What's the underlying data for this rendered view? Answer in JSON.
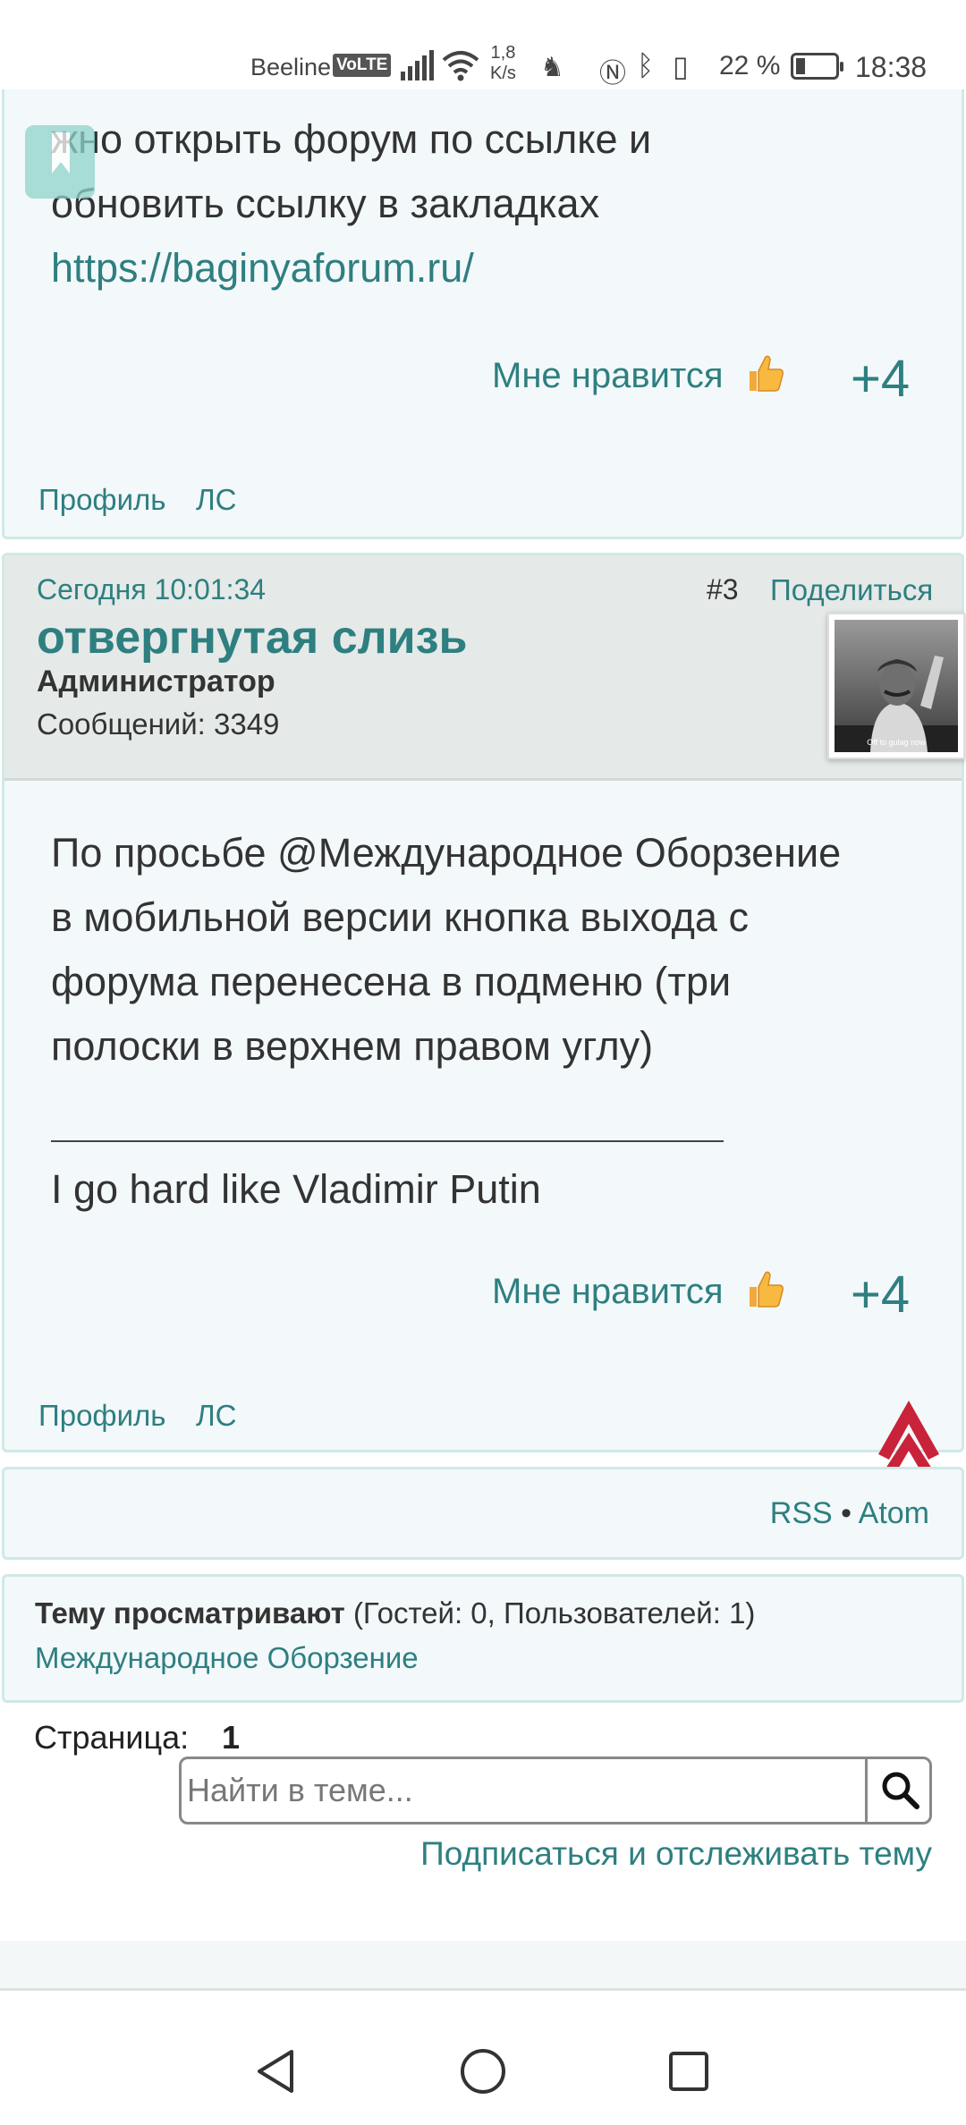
{
  "status_bar": {
    "carrier": "Beeline",
    "volte": "VoLTE",
    "speed_value": "1,8",
    "speed_unit": "K/s",
    "battery": "22 %",
    "time": "18:38",
    "icons": [
      "signal-icon",
      "wifi-icon",
      "nfc-icon",
      "bluetooth-icon",
      "vibrate-icon",
      "battery-icon"
    ]
  },
  "post1": {
    "body_lines": [
      "жно открыть форум по ссылке и",
      "обновить ссылку в закладках"
    ],
    "link": "https://baginyaforum.ru/",
    "like_label": "Мне нравится",
    "like_count": "+4",
    "profile_link": "Профиль",
    "pm_link": "ЛС"
  },
  "post2": {
    "date": "Сегодня 10:01:34",
    "number": "#3",
    "share": "Поделиться",
    "author": "отвергнутая слизь",
    "role": "Администратор",
    "messages": "Сообщений: 3349",
    "avatar_caption": "Off to gulag now",
    "body_lines": [
      "По просьбе @Международное Оборзение",
      "в мобильной версии кнопка выхода с",
      "форума перенесена в подменю (три",
      "полоски в верхнем правом углу)"
    ],
    "signature": "I go hard like Vladimir Putin",
    "like_label": "Мне нравится",
    "like_count": "+4",
    "profile_link": "Профиль",
    "pm_link": "ЛС"
  },
  "feeds": {
    "rss": "RSS",
    "separator": "•",
    "atom": "Atom"
  },
  "viewers": {
    "title": "Тему просматривают",
    "counts": "(Гостей: 0, Пользователей: 1)",
    "user": "Международное Оборзение"
  },
  "pagination": {
    "label": "Страница:",
    "current": "1"
  },
  "search": {
    "placeholder": "Найти в теме..."
  },
  "subscribe": "Подписаться и отслеживать тему",
  "colors": {
    "accent": "#2e7f80",
    "card_bg": "#f3f8fa",
    "card_border": "#cfe9e6",
    "header_bg": "#e5e9e8",
    "scroll_up": "#c8233a"
  }
}
